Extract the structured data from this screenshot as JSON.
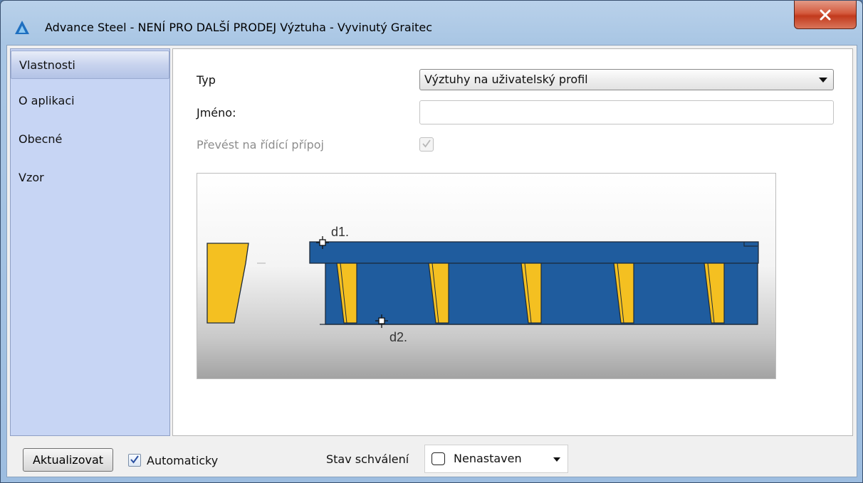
{
  "window": {
    "title": "Advance Steel - NENÍ PRO DALŠÍ PRODEJ   Výztuha - Vyvinutý Graitec",
    "app_icon": "advance-steel-logo-icon",
    "close_icon": "close-icon"
  },
  "sidebar": {
    "items": [
      {
        "label": "Vlastnosti",
        "active": true
      },
      {
        "label": "O aplikaci",
        "active": false
      },
      {
        "label": "Obecné",
        "active": false
      },
      {
        "label": "Vzor",
        "active": false
      }
    ]
  },
  "form": {
    "type_label": "Typ",
    "type_value": "Výztuhy na uživatelský profil",
    "name_label": "Jméno:",
    "name_value": "",
    "convert_label": "Převést na řídící přípoj",
    "convert_checked": true,
    "convert_disabled": true
  },
  "preview": {
    "point_labels": [
      "d1.",
      "d2."
    ],
    "colors": {
      "beam": "#1f5c9e",
      "stiffener": "#f4c021",
      "stroke": "#1c2a3a"
    }
  },
  "bottom": {
    "update_label": "Aktualizovat",
    "auto_label": "Automaticky",
    "auto_checked": true,
    "approval_label": "Stav schválení",
    "approval_value": "Nenastaven"
  }
}
